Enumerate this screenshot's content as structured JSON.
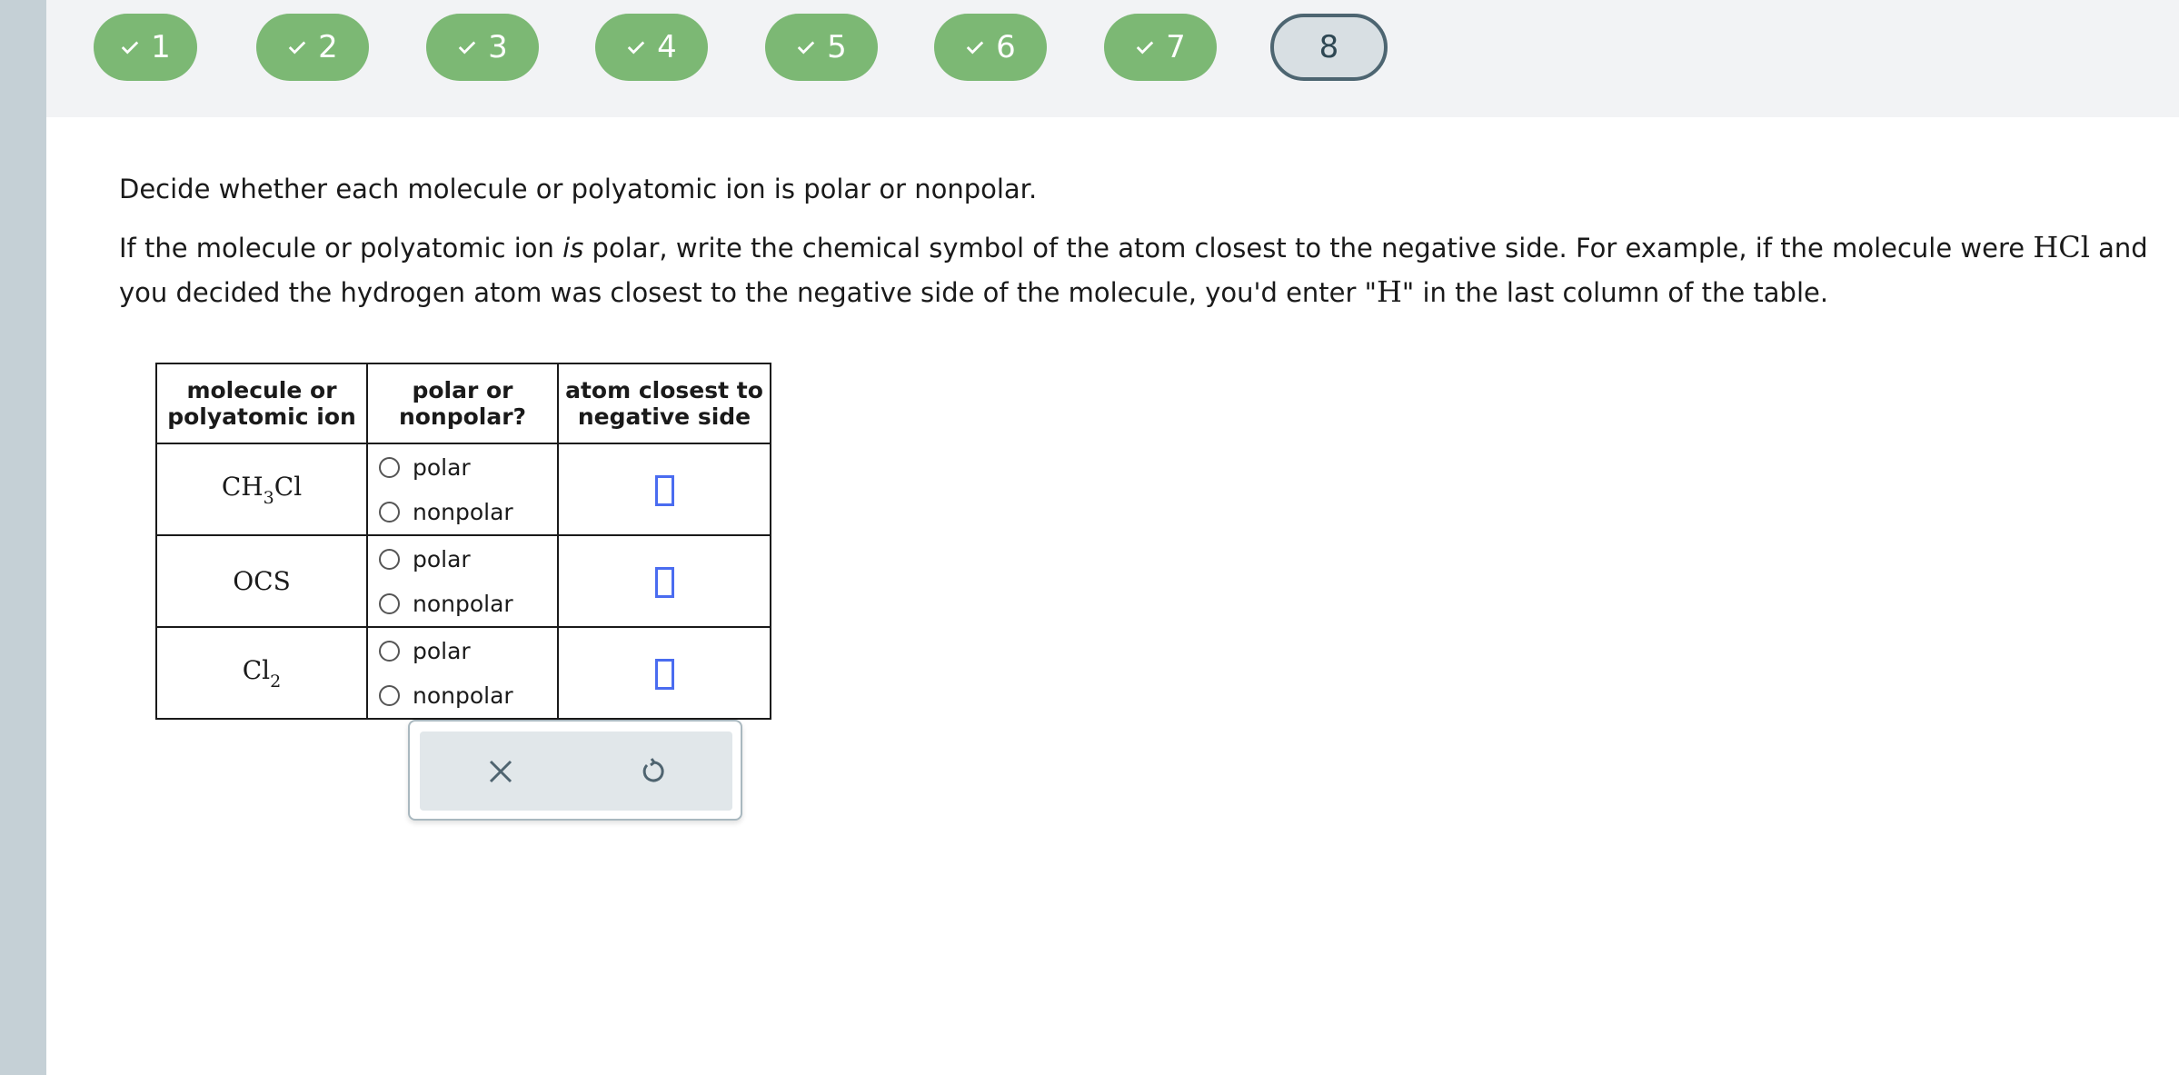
{
  "steps": [
    {
      "label": "1",
      "done": true
    },
    {
      "label": "2",
      "done": true
    },
    {
      "label": "3",
      "done": true
    },
    {
      "label": "4",
      "done": true
    },
    {
      "label": "5",
      "done": true
    },
    {
      "label": "6",
      "done": true
    },
    {
      "label": "7",
      "done": true
    },
    {
      "label": "8",
      "done": false,
      "current": true
    }
  ],
  "question": {
    "line1": "Decide whether each molecule or polyatomic ion is polar or nonpolar.",
    "line2_pre": "If the molecule or polyatomic ion ",
    "line2_em": "is",
    "line2_mid": " polar, write the chemical symbol of the atom closest to the negative side. For example, if the molecule were ",
    "example_formula": "HCl",
    "line2_mid2": " and you decided the hydrogen atom was closest to the negative side of the molecule, you'd enter \"",
    "example_atom": "H",
    "line2_end": "\" in the last column of the table."
  },
  "table": {
    "headers": [
      "molecule or polyatomic ion",
      "polar or nonpolar?",
      "atom closest to negative side"
    ],
    "option_polar": "polar",
    "option_nonpolar": "nonpolar",
    "rows": [
      {
        "formula_main": "CH",
        "formula_sub": "3",
        "formula_tail": "Cl"
      },
      {
        "formula_main": "OCS",
        "formula_sub": "",
        "formula_tail": ""
      },
      {
        "formula_main": "Cl",
        "formula_sub": "2",
        "formula_tail": ""
      }
    ]
  },
  "actions": {
    "clear_icon": "close-icon",
    "reset_icon": "undo-icon"
  },
  "colors": {
    "step_done": "#7cb874",
    "step_current": "#d8dfe3",
    "answer_box": "#4a6cf0",
    "sidebar": "#c5d0d6"
  }
}
